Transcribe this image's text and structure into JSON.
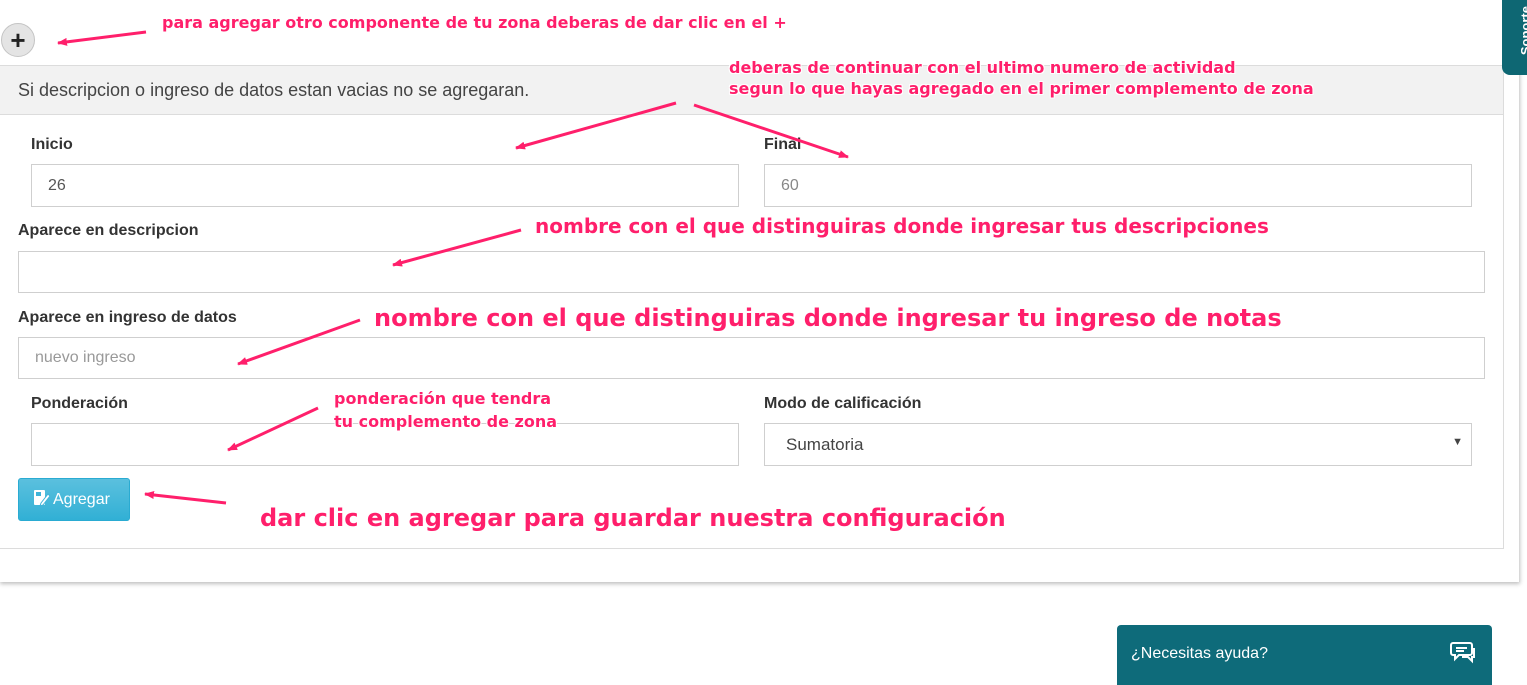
{
  "add_component_button": "+",
  "notice": "Si descripcion o ingreso de datos estan vacias no se agregaran.",
  "form": {
    "inicio": {
      "label": "Inicio",
      "value": "26"
    },
    "final": {
      "label": "Final",
      "value": "60"
    },
    "aparece_descripcion": {
      "label": "Aparece en descripcion",
      "value": ""
    },
    "aparece_ingreso": {
      "label": "Aparece en ingreso de datos",
      "placeholder": "nuevo ingreso"
    },
    "ponderacion": {
      "label": "Ponderación",
      "value": ""
    },
    "modo_calificacion": {
      "label": "Modo de calificación",
      "selected": "Sumatoria"
    },
    "agregar_button": "Agregar"
  },
  "soporte_tab": "Soporte",
  "help_widget": {
    "label": "¿Necesitas ayuda?",
    "icon": "chat-bubbles-icon"
  },
  "annotations": {
    "plus": "para agregar otro componente de tu zona deberas de dar clic en el +",
    "continuar_1": "deberas de continuar con el ultimo numero de actividad",
    "continuar_2": "segun lo que hayas agregado en el primer complemento de zona",
    "descripcion": "nombre con el que distinguiras donde ingresar tus descripciones",
    "ingreso": "nombre con el que distinguiras donde ingresar tu ingreso de notas",
    "ponderacion_1": "ponderación que tendra",
    "ponderacion_2": "tu complemento de zona",
    "agregar": "dar clic en agregar para guardar nuestra configuración"
  },
  "colors": {
    "annotation": "#ff1f6b",
    "button": "#5bc0de",
    "teal": "#0e6b7a"
  }
}
